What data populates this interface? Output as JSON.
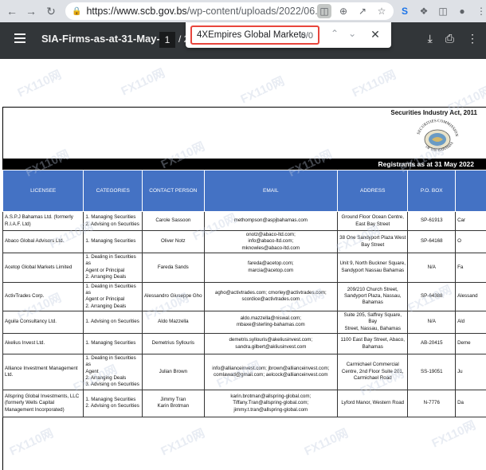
{
  "browser": {
    "url_host": "https://www.scb.gov.bs",
    "url_path": "/wp-content/uploads/2022/06...",
    "icons": [
      "back-arrow",
      "forward-arrow",
      "reload",
      "lock",
      "pdf-icon",
      "zoom-icon",
      "share-icon",
      "star-icon",
      "extension-icon",
      "puzzle-icon",
      "sidepanel-icon",
      "profile-icon",
      "menu-dots-icon"
    ]
  },
  "pdf_toolbar": {
    "title": "SIA-Firms-as-at-31-May-2...",
    "page_current": "1",
    "page_sep": "/ 2"
  },
  "find": {
    "query": "4XEmpires Global Markets",
    "count": "0/0"
  },
  "document": {
    "act_title": "Securities Industry Act, 2011",
    "seal_top": "SECURITIES COMMISSION",
    "seal_bottom": "OF THE BAHAMAS",
    "registrants": "Registrants as at 31 May 2022",
    "headers": [
      "LICENSEE",
      "CATEGORIES",
      "CONTACT PERSON",
      "EMAIL",
      "ADDRESS",
      "P.O. BOX"
    ],
    "rows": [
      {
        "licensee": "A.S.P.J Bahamas Ltd. (formerly R.I.A.F. Ltd)",
        "categories": [
          "1. Managing Securities",
          "2. Advising on Securities"
        ],
        "contact": [
          "Carole Sassoon"
        ],
        "email": [
          "methompson@aspjbahamas.com"
        ],
        "address": [
          "Ground Floor  Ocean Centre,",
          "East Bay Street"
        ],
        "pobox": "SP-61913",
        "extra": "Car"
      },
      {
        "licensee": "Abaco Global Advisors Ltd.",
        "categories": [
          "1. Managing Securities"
        ],
        "contact": [
          "Oliver Notz"
        ],
        "email": [
          "onotz@abaco-ltd.com;",
          "info@abaco-ltd.com;",
          "mknowles@abaco-ltd.com"
        ],
        "address": [
          "38 One Sandyport Plaza  West",
          "Bay Street"
        ],
        "pobox": "SP-64168",
        "extra": "O"
      },
      {
        "licensee": "Acetop Global Markets Limited",
        "categories": [
          "1. Dealing in Securities as",
          "Agent or Principal",
          "2. Arranging Deals"
        ],
        "contact": [
          "Fareda Sands"
        ],
        "email": [
          "fareda@acetop.com;",
          "marcia@acetop.com"
        ],
        "address": [
          "Unit 9, North Buckner Square,",
          "Sandyport Nassau Bahamas"
        ],
        "pobox": "N/A",
        "extra": "Fa"
      },
      {
        "licensee": "ActivTrades Corp.",
        "categories": [
          "1. Dealing in Securities as",
          "Agent or Principal",
          "2. Arranging Deals"
        ],
        "contact": [
          "Alessandro Giuseppe Gho"
        ],
        "email": [
          "agho@activtrades.com; cmorley@activtrades.com;",
          "scordice@activtrades.com"
        ],
        "address": [
          "209/210 Church Street,",
          "Sandyport Plaza, Nassau,",
          "Bahamas"
        ],
        "pobox": "SP-64388",
        "extra": "Alessand"
      },
      {
        "licensee": "Aguila Consultancy Ltd.",
        "categories": [
          "1. Advising on Securities"
        ],
        "contact": [
          "Aldo Mazzella"
        ],
        "email": [
          "aldo.mazzella@niswal.com;",
          "mbaxe@sterling-bahamas.com"
        ],
        "address": [
          "Suite 205, Saffrey Square, Bay",
          "Street, Nassau, Bahamas"
        ],
        "pobox": "N/A",
        "extra": "Ald"
      },
      {
        "licensee": "Akelius Invest Ltd.",
        "categories": [
          "1. Managing Securities"
        ],
        "contact": [
          "Demetrius Syllouris"
        ],
        "email": [
          "demetris.syllouris@akeliusinvest.com;",
          "sandra.gilbert@akliusinvest.com"
        ],
        "address": [
          "1100 East Bay Street, Abaco,",
          "Bahamas"
        ],
        "pobox": "AB-20415",
        "extra": "Deme"
      },
      {
        "licensee": "Alliance Investment Management Ltd.",
        "categories": [
          "1. Dealing in Securities as",
          "Agent",
          "2. Arranging Deals",
          "3. Advising on Securities"
        ],
        "contact": [
          "Julian Brown"
        ],
        "email": [
          "info@allianceinvest.com; jbrown@allianceinvest.com;",
          "comlawad@gmail.com; aelcock@allianceinvest.com"
        ],
        "address": [
          "Carmichael Commercial",
          "Centre, 2nd Floor Suite 201,",
          "Carmichael Road"
        ],
        "pobox": "SS-19051",
        "extra": "Ju"
      },
      {
        "licensee": "Allspring Global Investments, LLC (formerly Wells Capital Management Incorporated)",
        "categories": [
          "1. Managing Securities",
          "2. Advising on Securities"
        ],
        "contact": [
          "Jimmy Tran",
          "Karin Brotman"
        ],
        "email": [
          "karin.brotman@allspring-global.com;",
          "Tiffany.Tran@allspring-global.com;",
          "jimmy.t.tran@allspring-global.com"
        ],
        "address": [
          "Lyford Manor, Western Road"
        ],
        "pobox": "N-7776",
        "extra": "Da"
      }
    ]
  }
}
